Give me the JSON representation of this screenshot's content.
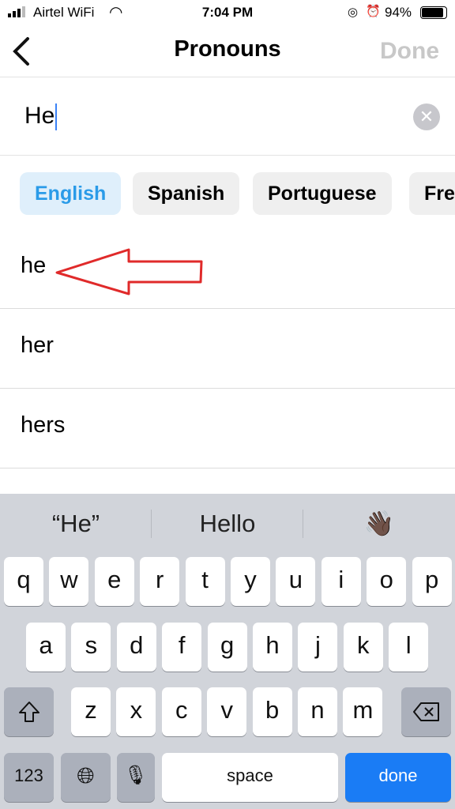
{
  "status": {
    "carrier": "Airtel WiFi",
    "time": "7:04 PM",
    "battery": "94%"
  },
  "nav": {
    "title": "Pronouns",
    "done": "Done",
    "back_icon": "chevron-left-icon"
  },
  "search": {
    "value": "He"
  },
  "chips": [
    {
      "label": "English",
      "selected": true
    },
    {
      "label": "Spanish"
    },
    {
      "label": "Portuguese"
    },
    {
      "label": "Fre"
    }
  ],
  "results": [
    "he",
    "her",
    "hers"
  ],
  "annotation": {
    "color": "#e02a2a",
    "shape": "arrow-left"
  },
  "keyboard": {
    "suggestions": [
      "“He”",
      "Hello",
      "👋🏿"
    ],
    "row1": [
      "q",
      "w",
      "e",
      "r",
      "t",
      "y",
      "u",
      "i",
      "o",
      "p"
    ],
    "row2": [
      "a",
      "s",
      "d",
      "f",
      "g",
      "h",
      "j",
      "k",
      "l"
    ],
    "row3": [
      "z",
      "x",
      "c",
      "v",
      "b",
      "n",
      "m"
    ],
    "num": "123",
    "space": "space",
    "done": "done",
    "done_color": "#1a7cf5"
  }
}
